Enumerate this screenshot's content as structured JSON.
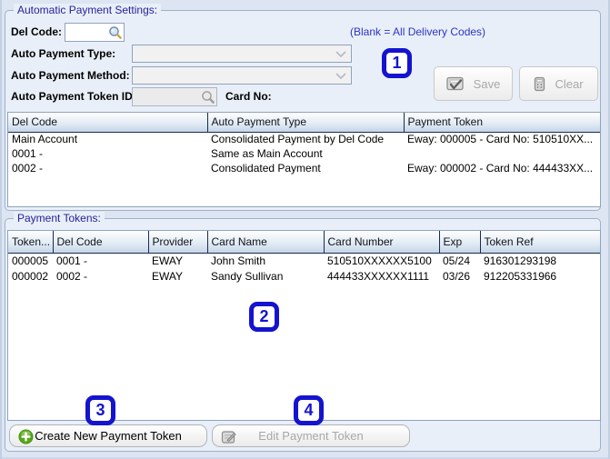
{
  "settings": {
    "title": "Automatic Payment Settings:",
    "del_code": {
      "label": "Del Code:",
      "value": ""
    },
    "hint": "(Blank = All Delivery Codes)",
    "auto_payment_type": {
      "label": "Auto Payment Type:",
      "value": ""
    },
    "auto_payment_method": {
      "label": "Auto Payment Method:",
      "value": ""
    },
    "auto_payment_token_id": {
      "label": "Auto Payment Token ID:",
      "value": ""
    },
    "card_no": {
      "label": "Card No:",
      "value": ""
    },
    "buttons": {
      "save": "Save",
      "clear": "Clear"
    },
    "table": {
      "columns": [
        "Del Code",
        "Auto Payment Type",
        "Payment Token"
      ],
      "rows": [
        [
          "Main Account",
          "Consolidated Payment by Del Code",
          "Eway: 000005 - Card No: 510510XX..."
        ],
        [
          "0001 -",
          "Same as Main Account",
          ""
        ],
        [
          "0002 -",
          "Consolidated Payment",
          "Eway: 000002 - Card No: 444433XX..."
        ]
      ]
    }
  },
  "tokens": {
    "title": "Payment Tokens:",
    "table": {
      "columns": [
        "Token...",
        "Del Code",
        "Provider",
        "Card Name",
        "Card Number",
        "Exp",
        "Token Ref"
      ],
      "rows": [
        [
          "000005",
          "0001 -",
          "EWAY",
          "John Smith",
          "510510XXXXXX5100",
          "05/24",
          "916301293198"
        ],
        [
          "000002",
          "0002 -",
          "EWAY",
          "Sandy Sullivan",
          "444433XXXXXX1111",
          "03/26",
          "912205331966"
        ]
      ]
    },
    "buttons": {
      "create": "Create New Payment Token",
      "edit": "Edit Payment Token"
    }
  },
  "annotations": [
    "1",
    "2",
    "3",
    "4"
  ],
  "colors": {
    "annotation_blue": "#1414cf",
    "group_title_blue": "#23239b",
    "hint_blue": "#2a35c8",
    "header_separator_navy": "#1c2b49",
    "create_plus_green": "#57a617",
    "panel_background": "#dce5f1",
    "groupbox_background": "#e9eff8"
  }
}
